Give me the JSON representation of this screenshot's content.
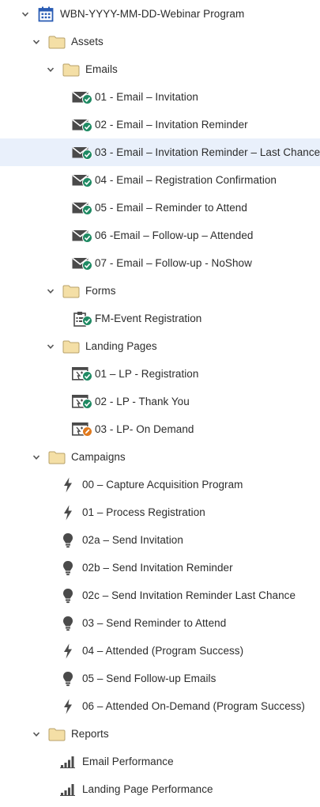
{
  "tree": {
    "program": {
      "label": "WBN-YYYY-MM-DD-Webinar Program",
      "icon": "calendar-program-icon"
    },
    "assets": {
      "label": "Assets",
      "emails": {
        "label": "Emails",
        "items": [
          "01 - Email – Invitation",
          "02 - Email – Invitation Reminder",
          "03 - Email – Invitation Reminder – Last Chance",
          "04 - Email – Registration Confirmation",
          "05 - Email – Reminder to Attend",
          "06 -Email – Follow-up – Attended",
          "07 - Email – Follow-up - NoShow"
        ],
        "selected_index": 2
      },
      "forms": {
        "label": "Forms",
        "items": [
          "FM-Event Registration"
        ]
      },
      "landing_pages": {
        "label": "Landing Pages",
        "items": [
          {
            "label": "01 – LP - Registration",
            "status": "approved"
          },
          {
            "label": "02 - LP - Thank You",
            "status": "approved"
          },
          {
            "label": "03 - LP- On Demand",
            "status": "draft"
          }
        ]
      }
    },
    "campaigns": {
      "label": "Campaigns",
      "items": [
        {
          "label": "00 – Capture Acquisition Program",
          "type": "trigger"
        },
        {
          "label": "01 – Process Registration",
          "type": "trigger"
        },
        {
          "label": "02a – Send Invitation",
          "type": "batch"
        },
        {
          "label": "02b – Send Invitation Reminder",
          "type": "batch"
        },
        {
          "label": "02c – Send Invitation Reminder Last Chance",
          "type": "batch"
        },
        {
          "label": "03 – Send Reminder to Attend",
          "type": "batch"
        },
        {
          "label": "04 – Attended (Program Success)",
          "type": "trigger"
        },
        {
          "label": "05 – Send Follow-up Emails",
          "type": "batch"
        },
        {
          "label": "06 – Attended On-Demand (Program Success)",
          "type": "trigger"
        }
      ]
    },
    "reports": {
      "label": "Reports",
      "items": [
        "Email Performance",
        "Landing Page Performance"
      ]
    }
  },
  "colors": {
    "selected_row": "#e9f0fb",
    "program_blue": "#2a5cb4",
    "folder_fill": "#f4dfa6",
    "folder_stroke": "#b8a26a",
    "approved_green": "#1f8a63",
    "draft_orange": "#e07a1f",
    "icon_gray": "#4a4a4a"
  }
}
